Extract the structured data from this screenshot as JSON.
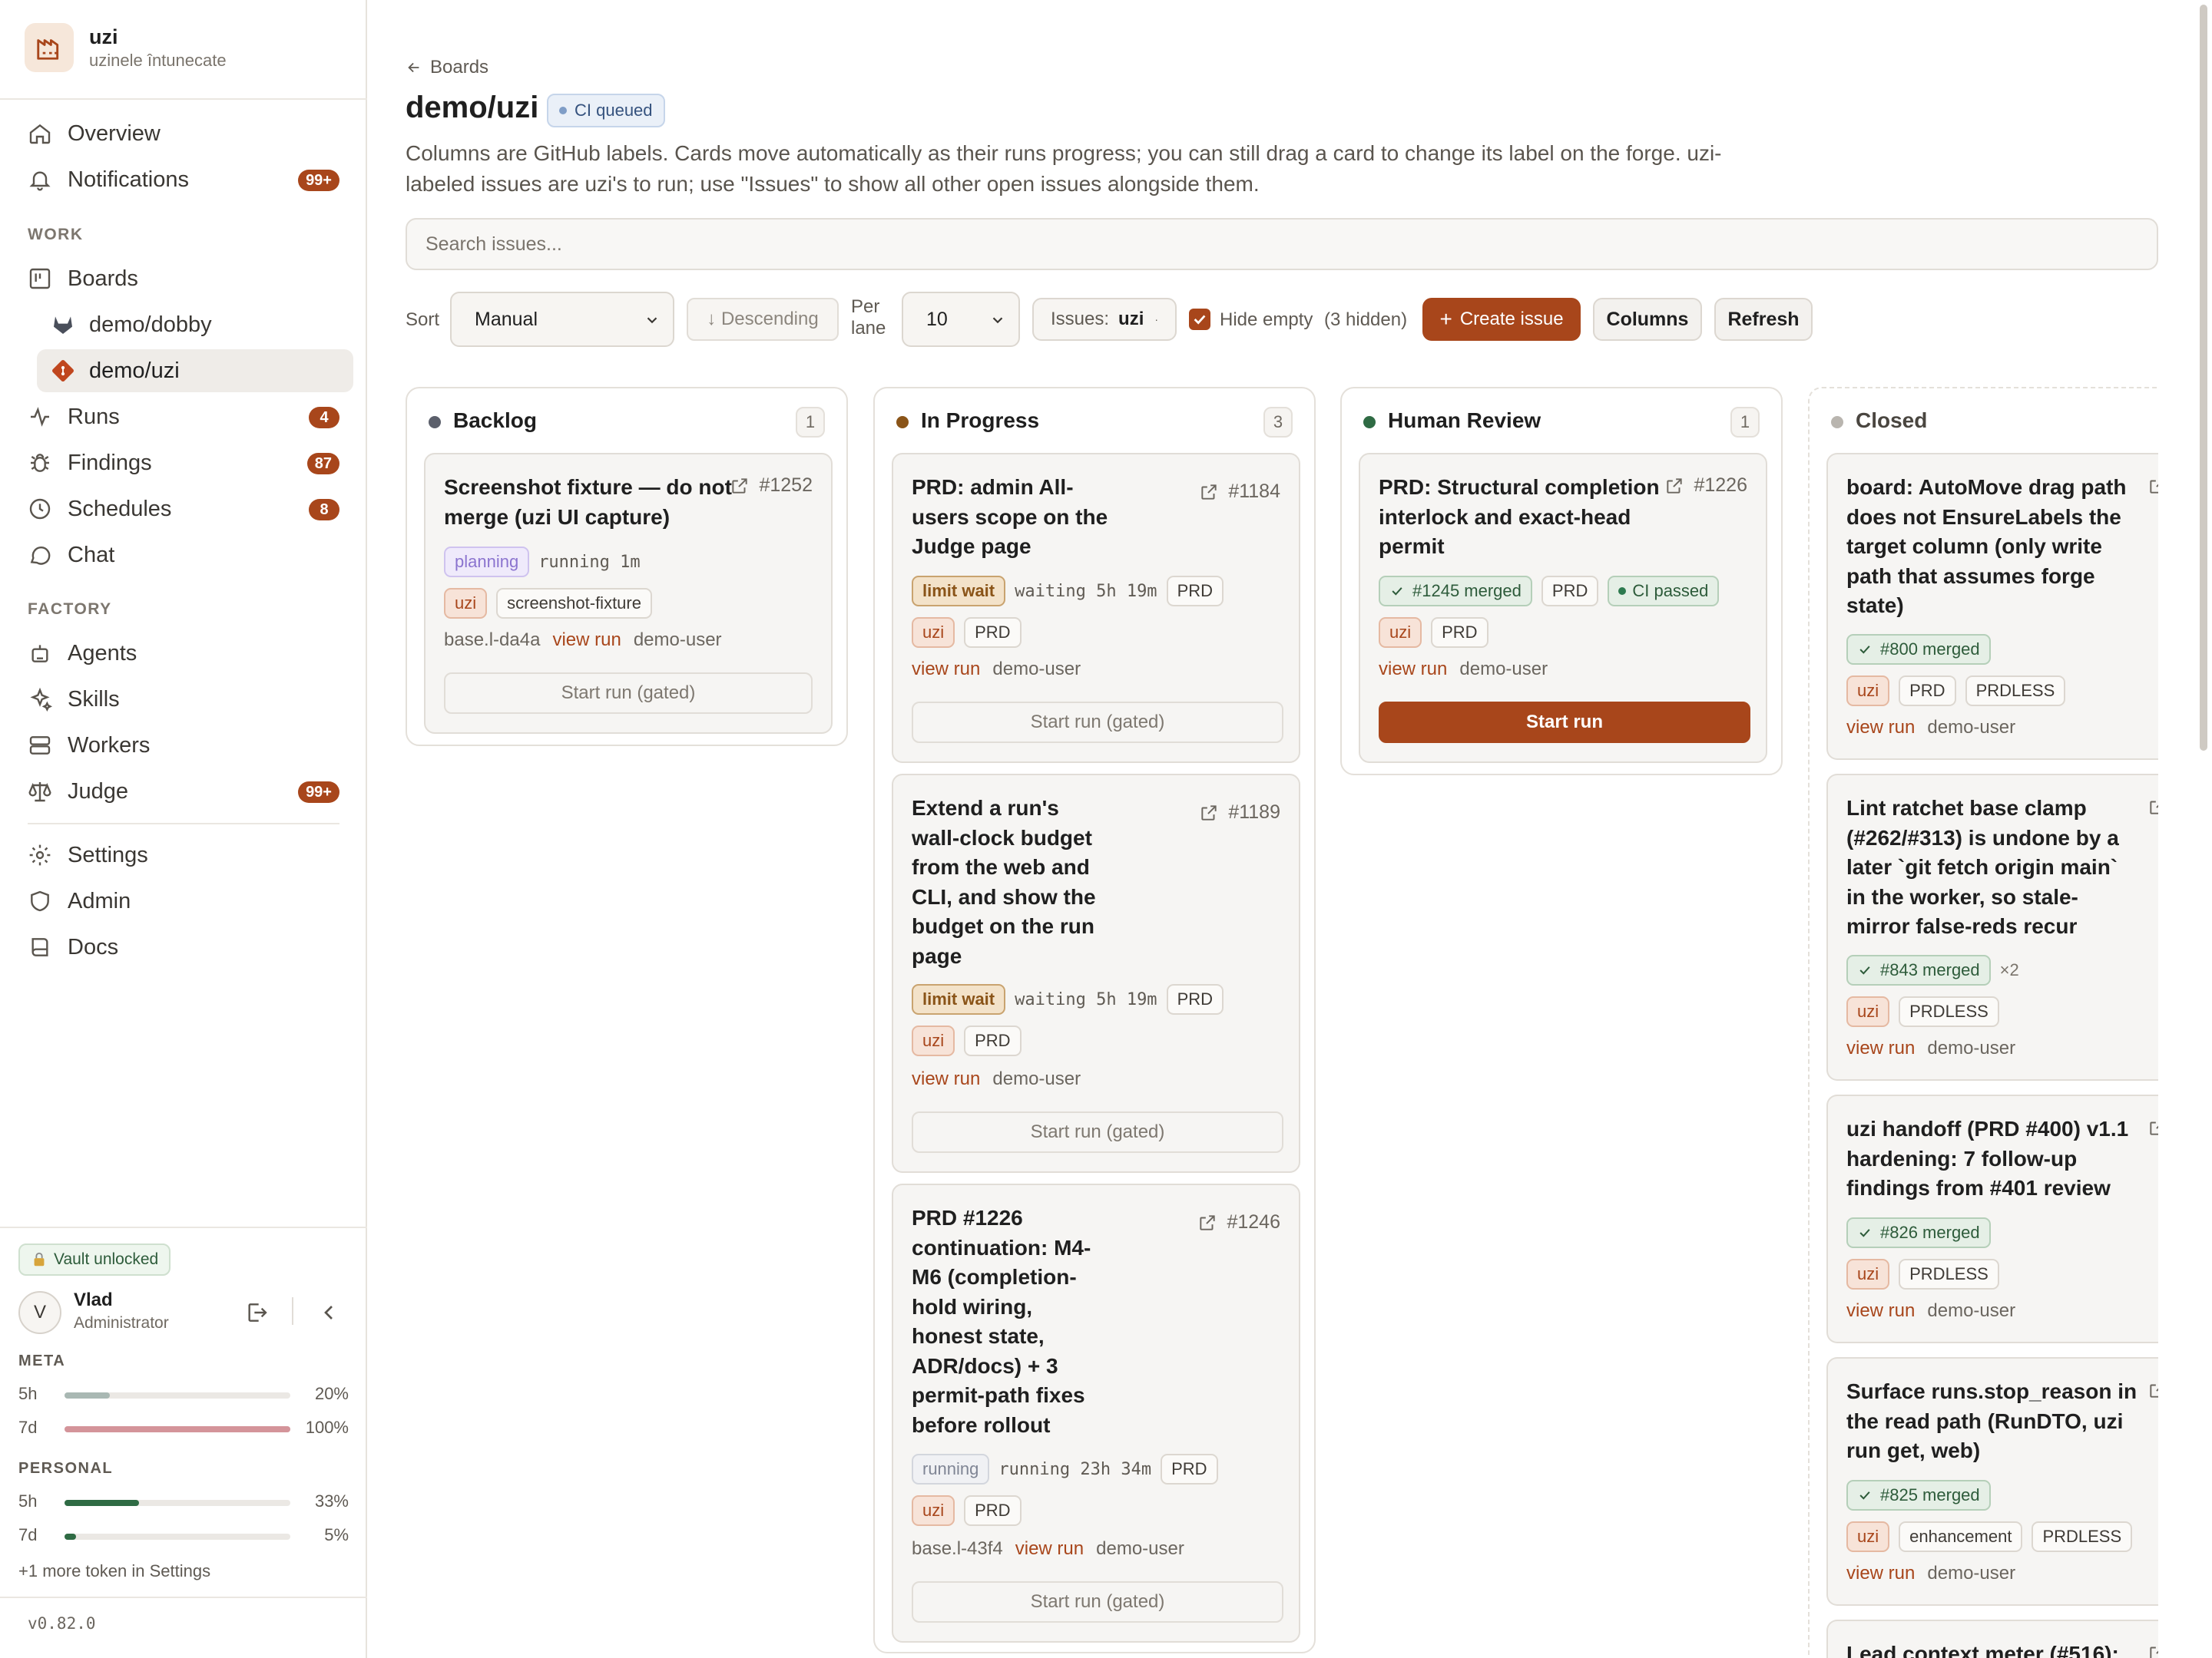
{
  "brand": {
    "name": "uzi",
    "subtitle": "uzinele întunecate"
  },
  "sidebar": {
    "nav": [
      {
        "label": "Overview"
      },
      {
        "label": "Notifications",
        "badge": "99+"
      }
    ],
    "work_section": "WORK",
    "work": [
      {
        "label": "Boards"
      },
      {
        "label": "demo/dobby"
      },
      {
        "label": "demo/uzi"
      },
      {
        "label": "Runs",
        "badge": "4"
      },
      {
        "label": "Findings",
        "badge": "87"
      },
      {
        "label": "Schedules",
        "badge": "8"
      },
      {
        "label": "Chat"
      }
    ],
    "factory_section": "FACTORY",
    "factory": [
      {
        "label": "Agents"
      },
      {
        "label": "Skills"
      },
      {
        "label": "Workers"
      },
      {
        "label": "Judge",
        "badge": "99+"
      }
    ],
    "bottom": [
      {
        "label": "Settings"
      },
      {
        "label": "Admin"
      },
      {
        "label": "Docs"
      }
    ],
    "vault": "Vault unlocked",
    "user": {
      "initial": "V",
      "name": "Vlad",
      "role": "Administrator"
    },
    "quota": {
      "meta_label": "META",
      "meta": [
        {
          "label": "5h",
          "value": "20%",
          "fraction": 0.2,
          "color": "#a9b8b3"
        },
        {
          "label": "7d",
          "value": "100%",
          "fraction": 1.0,
          "color": "#d4949a"
        }
      ],
      "personal_label": "PERSONAL",
      "personal": [
        {
          "label": "5h",
          "value": "33%",
          "fraction": 0.33,
          "color": "#2f6b44"
        },
        {
          "label": "7d",
          "value": "5%",
          "fraction": 0.05,
          "color": "#2f6b44"
        }
      ],
      "more": "+1 more token in Settings"
    },
    "version": "v0.82.0"
  },
  "header": {
    "back": "Boards",
    "title": "demo/uzi",
    "ci_badge": "CI queued",
    "description": "Columns are GitHub labels. Cards move automatically as their runs progress; you can still drag a card to change its label on the forge. uzi-labeled issues are uzi's to run; use \"Issues\" to show all other open issues alongside them.",
    "search_placeholder": "Search issues..."
  },
  "toolbar": {
    "sort_label": "Sort",
    "sort_value": "Manual",
    "order": "↓ Descending",
    "per_lane_label_1": "Per",
    "per_lane_label_2": "lane",
    "per_lane_value": "10",
    "issues_label": "Issues:",
    "issues_value": "uzi",
    "hide_empty_label": "Hide empty",
    "hidden_count": "(3 hidden)",
    "create_issue": "Create issue",
    "columns": "Columns",
    "refresh": "Refresh"
  },
  "lanes": {
    "backlog": {
      "title": "Backlog",
      "count": "1",
      "dot": "#5b5f6b",
      "cards": [
        {
          "title_lines": [
            "Screenshot fixture — do not",
            "merge (uzi UI capture)"
          ],
          "number": "#1252",
          "status": "planning",
          "status_text": "running 1m",
          "labels": [
            "uzi",
            "screenshot-fixture"
          ],
          "base": "base.l-da4a",
          "view_run": "view run",
          "user": "demo-user",
          "action": "Start run (gated)"
        }
      ]
    },
    "in_progress": {
      "title": "In Progress",
      "count": "3",
      "dot": "#8a5418",
      "cards": [
        {
          "title_lines": [
            "PRD: admin All-",
            "users scope on the",
            "Judge page"
          ],
          "number": "#1184",
          "status": "limit wait",
          "status_text": "waiting 5h 19m",
          "status_tag": "PRD",
          "labels": [
            "uzi",
            "PRD"
          ],
          "view_run": "view run",
          "user": "demo-user",
          "action": "Start run (gated)"
        },
        {
          "title_lines": [
            "Extend a run's",
            "wall-clock budget",
            "from the web and",
            "CLI, and show the",
            "budget on the run",
            "page"
          ],
          "number": "#1189",
          "status": "limit wait",
          "status_text": "waiting 5h 19m",
          "status_tag": "PRD",
          "labels": [
            "uzi",
            "PRD"
          ],
          "view_run": "view run",
          "user": "demo-user",
          "action": "Start run (gated)"
        },
        {
          "title_lines": [
            "PRD #1226",
            "continuation: M4-",
            "M6 (completion-",
            "hold wiring,",
            "honest state,",
            "ADR/docs) + 3",
            "permit-path fixes",
            "before rollout"
          ],
          "number": "#1246",
          "status": "running",
          "status_text": "running 23h 34m",
          "status_tag": "PRD",
          "labels": [
            "uzi",
            "PRD"
          ],
          "base": "base.l-43f4",
          "view_run": "view run",
          "user": "demo-user",
          "action": "Start run (gated)"
        }
      ]
    },
    "human_review": {
      "title": "Human Review",
      "count": "1",
      "dot": "#2f6b44",
      "cards": [
        {
          "title_lines": [
            "PRD: Structural completion",
            "interlock and exact-head",
            "permit"
          ],
          "number": "#1226",
          "merged": "#1245 merged",
          "tag": "PRD",
          "ci": "CI passed",
          "labels": [
            "uzi",
            "PRD"
          ],
          "view_run": "view run",
          "user": "demo-user",
          "action": "Start run"
        }
      ]
    },
    "closed": {
      "title": "Closed",
      "dot": "#b9b5af",
      "cards": [
        {
          "title_lines": [
            "board: AutoMove drag path",
            "does not EnsureLabels the",
            "target column (only write",
            "path that assumes forge",
            "state)"
          ],
          "merged": "#800 merged",
          "labels": [
            "uzi",
            "PRD",
            "PRDLESS"
          ],
          "view_run": "view run",
          "user": "demo-user"
        },
        {
          "title_lines": [
            "Lint ratchet base clamp",
            "(#262/#313) is undone by a",
            "later `git fetch origin main`",
            "in the worker, so stale-",
            "mirror false-reds recur"
          ],
          "merged": "#843 merged",
          "multiplier": "×2",
          "labels": [
            "uzi",
            "PRDLESS"
          ],
          "view_run": "view run",
          "user": "demo-user"
        },
        {
          "title_lines": [
            "uzi handoff (PRD #400) v1.1",
            "hardening: 7 follow-up",
            "findings from #401 review"
          ],
          "merged": "#826 merged",
          "labels": [
            "uzi",
            "PRDLESS"
          ],
          "view_run": "view run",
          "user": "demo-user"
        },
        {
          "title_lines": [
            "Surface runs.stop_reason in",
            "the read path (RunDTO, uzi",
            "run get, web)"
          ],
          "merged": "#825 merged",
          "labels": [
            "uzi",
            "enhancement",
            "PRDLESS"
          ],
          "view_run": "view run",
          "user": "demo-user"
        },
        {
          "title_lines": [
            "Lead context meter (#516):"
          ]
        }
      ]
    }
  }
}
